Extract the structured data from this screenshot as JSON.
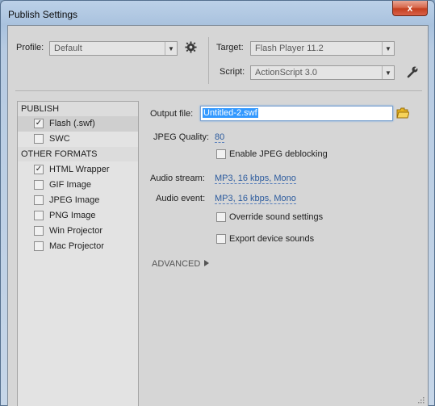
{
  "window": {
    "title": "Publish Settings",
    "close_label": "x"
  },
  "profile": {
    "label": "Profile:",
    "value": "Default"
  },
  "target": {
    "label": "Target:",
    "value": "Flash Player 11.2"
  },
  "script": {
    "label": "Script:",
    "value": "ActionScript 3.0"
  },
  "left_panel": {
    "publish_header": "PUBLISH",
    "publish_items": [
      {
        "label": "Flash (.swf)",
        "checked": true,
        "selected": true
      },
      {
        "label": "SWC",
        "checked": false,
        "selected": false
      }
    ],
    "other_header": "OTHER FORMATS",
    "other_items": [
      {
        "label": "HTML Wrapper",
        "checked": true
      },
      {
        "label": "GIF Image",
        "checked": false
      },
      {
        "label": "JPEG Image",
        "checked": false
      },
      {
        "label": "PNG Image",
        "checked": false
      },
      {
        "label": "Win Projector",
        "checked": false
      },
      {
        "label": "Mac Projector",
        "checked": false
      }
    ]
  },
  "settings": {
    "output_file_label": "Output file:",
    "output_file_value": "Untitled-2.swf",
    "jpeg_quality_label": "JPEG Quality:",
    "jpeg_quality_value": "80",
    "jpeg_deblocking_label": "Enable JPEG deblocking",
    "audio_stream_label": "Audio stream:",
    "audio_stream_value": "MP3, 16 kbps, Mono",
    "audio_event_label": "Audio event:",
    "audio_event_value": "MP3, 16 kbps, Mono",
    "override_sound_label": "Override sound settings",
    "export_device_label": "Export device sounds",
    "advanced_label": "ADVANCED"
  },
  "icons": {
    "gear": "gear-icon",
    "wrench": "wrench-icon",
    "folder": "folder-icon",
    "check": "✓"
  },
  "colors": {
    "link": "#2c5b9e",
    "selection": "#3399ff",
    "close": "#c4401f"
  }
}
